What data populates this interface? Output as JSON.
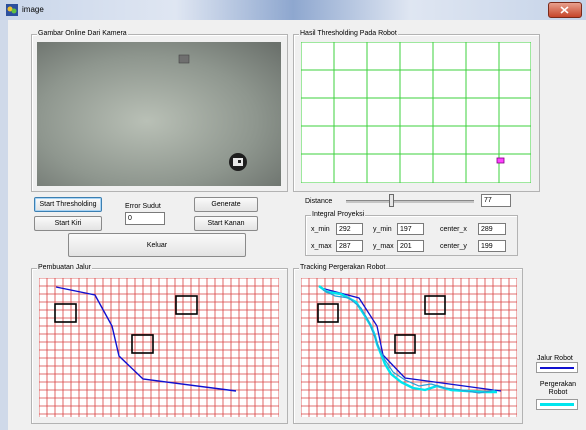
{
  "window": {
    "title": "image"
  },
  "camera": {
    "title": "Gambar Online Dari Kamera"
  },
  "threshold": {
    "title": "Hasil Thresholding Pada Robot"
  },
  "controls": {
    "start_thresholding": "Start Thresholding",
    "error_label": "Error Sudut",
    "error_value": "0",
    "generate": "Generate",
    "start_kiri": "Start Kiri",
    "start_kanan": "Start Kanan",
    "keluar": "Keluar"
  },
  "distance": {
    "label": "Distance",
    "value": "77",
    "slider_fraction": 0.35
  },
  "proyeksi": {
    "title": "Integral Proyeksi",
    "x_min_label": "x_min",
    "x_min": "292",
    "y_min_label": "y_min",
    "y_min": "197",
    "center_x_label": "center_x",
    "center_x": "289",
    "x_max_label": "x_max",
    "x_max": "287",
    "y_max_label": "y_max",
    "y_max": "201",
    "center_y_label": "center_y",
    "center_y": "199"
  },
  "pembuatan": {
    "title": "Pembuatan Jalur"
  },
  "tracking": {
    "title": "Tracking Pergerakan Robot"
  },
  "legend": {
    "jalur_label": "Jalur Robot",
    "jalur_color": "#1010d0",
    "gerak_label": "Pergerakan Robot",
    "gerak_color": "#00e5ee"
  }
}
